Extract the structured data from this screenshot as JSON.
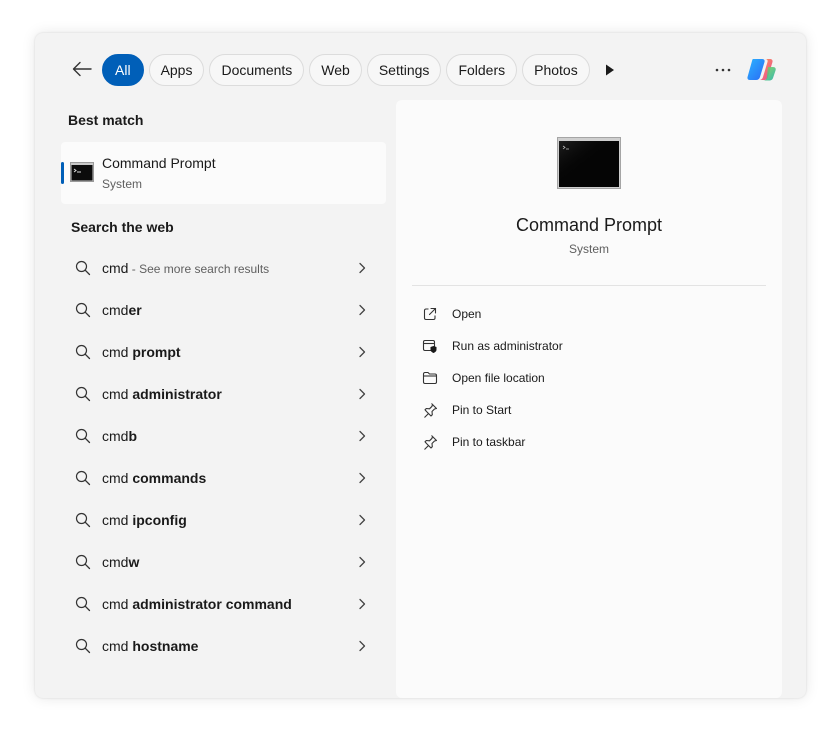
{
  "filters": {
    "tabs": [
      {
        "label": "All",
        "active": true
      },
      {
        "label": "Apps"
      },
      {
        "label": "Documents"
      },
      {
        "label": "Web"
      },
      {
        "label": "Settings"
      },
      {
        "label": "Folders"
      },
      {
        "label": "Photos"
      }
    ]
  },
  "best_match": {
    "heading": "Best match",
    "title": "Command Prompt",
    "subtitle": "System"
  },
  "web": {
    "heading": "Search the web",
    "items": [
      {
        "prefix": "cmd",
        "bold": "",
        "note": " - See more search results"
      },
      {
        "prefix": "cmd",
        "bold": "er",
        "note": ""
      },
      {
        "prefix": "cmd ",
        "bold": "prompt",
        "note": ""
      },
      {
        "prefix": "cmd ",
        "bold": "administrator",
        "note": ""
      },
      {
        "prefix": "cmd",
        "bold": "b",
        "note": ""
      },
      {
        "prefix": "cmd ",
        "bold": "commands",
        "note": ""
      },
      {
        "prefix": "cmd ",
        "bold": "ipconfig",
        "note": ""
      },
      {
        "prefix": "cmd",
        "bold": "w",
        "note": ""
      },
      {
        "prefix": "cmd ",
        "bold": "administrator command",
        "note": ""
      },
      {
        "prefix": "cmd ",
        "bold": "hostname",
        "note": ""
      }
    ]
  },
  "details": {
    "title": "Command Prompt",
    "subtitle": "System",
    "actions": [
      {
        "label": "Open",
        "icon": "open-external-icon"
      },
      {
        "label": "Run as administrator",
        "icon": "shield-admin-icon"
      },
      {
        "label": "Open file location",
        "icon": "folder-icon"
      },
      {
        "label": "Pin to Start",
        "icon": "pin-icon"
      },
      {
        "label": "Pin to taskbar",
        "icon": "pin-icon"
      }
    ]
  },
  "colors": {
    "accent": "#005fb8",
    "panel": "#f3f3f3",
    "card": "#fbfbfb"
  }
}
